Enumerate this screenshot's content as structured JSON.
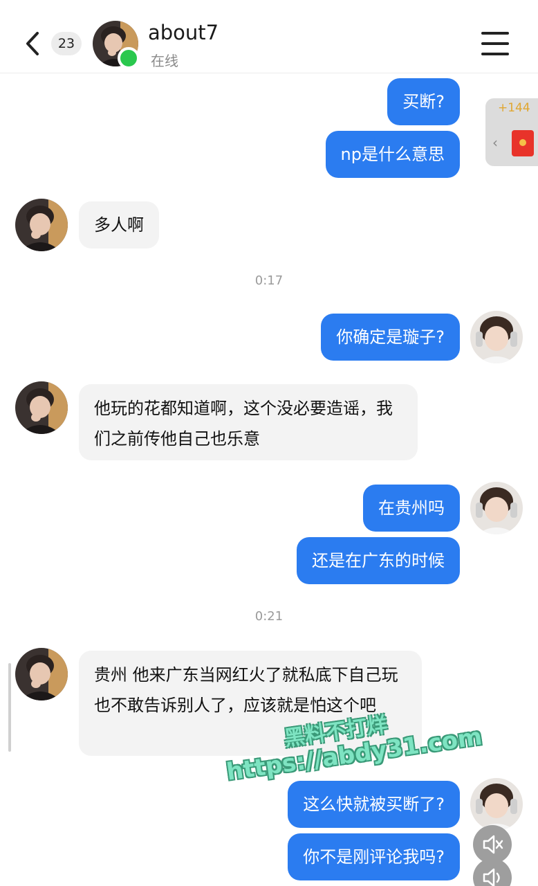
{
  "header": {
    "unread_count": "23",
    "contact_name": "about7",
    "status": "在线"
  },
  "red_packet": {
    "count": "+144"
  },
  "messages": [
    {
      "dir": "out",
      "text": "买断?"
    },
    {
      "dir": "out",
      "text": "np是什么意思"
    },
    {
      "dir": "in",
      "text": "多人啊"
    },
    {
      "type": "time",
      "text": "0:17"
    },
    {
      "dir": "out",
      "text": "你确定是璇子?"
    },
    {
      "dir": "in",
      "text": "他玩的花都知道啊，这个没必要造谣，我们之前传他自己也乐意"
    },
    {
      "dir": "out",
      "text": "在贵州吗"
    },
    {
      "dir": "out",
      "text": "还是在广东的时候"
    },
    {
      "type": "time",
      "text": "0:21"
    },
    {
      "dir": "in",
      "text": "贵州 他来广东当网红火了就私底下自己玩也不敢告诉别人了，应该就是怕这个吧"
    },
    {
      "dir": "out",
      "text": "这么快就被买断了?"
    },
    {
      "dir": "out",
      "text": "你不是刚评论我吗?"
    }
  ],
  "watermark": {
    "line1": "黑料不打烊",
    "line2": "https://abdy31.com"
  },
  "icons": {
    "back": "chevron-left-icon",
    "menu": "hamburger-menu-icon",
    "mute": "speaker-muted-icon",
    "volume": "speaker-volume-icon"
  },
  "colors": {
    "outgoing_bubble": "#2b7cf0",
    "incoming_bubble": "#f3f3f3",
    "online": "#2ac84e"
  }
}
